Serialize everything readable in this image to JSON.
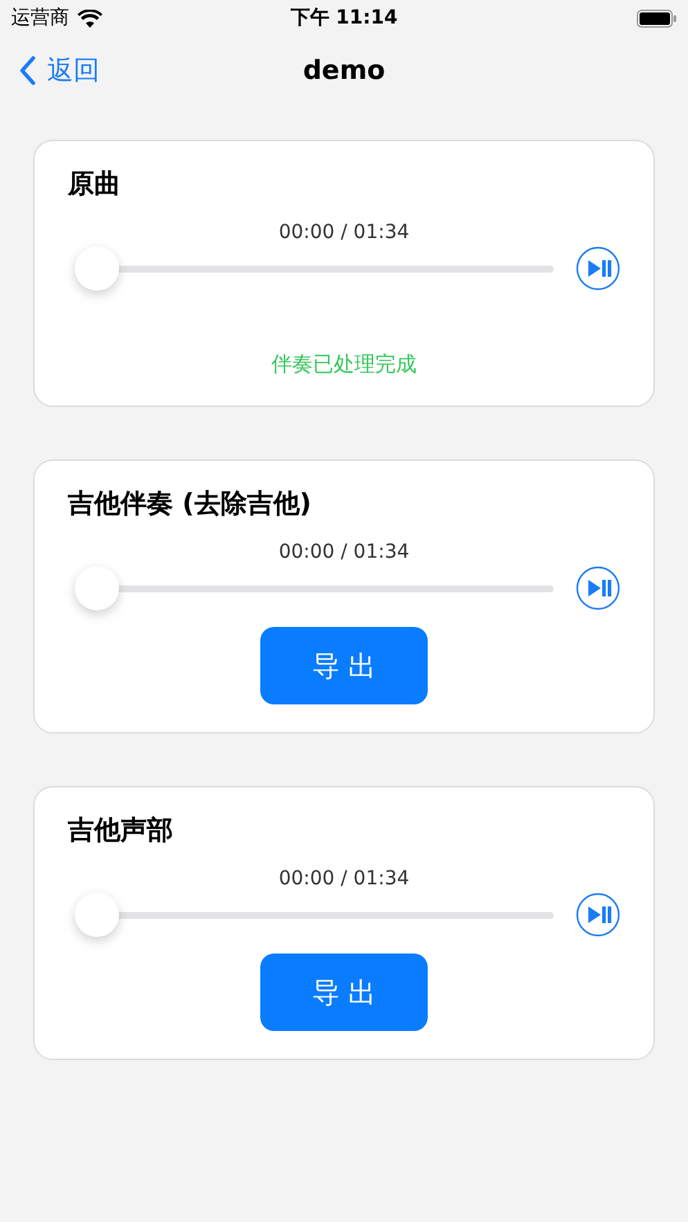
{
  "status_bar": {
    "carrier": "运营商",
    "time": "下午 11:14"
  },
  "nav": {
    "back": "返回",
    "title": "demo"
  },
  "tracks": [
    {
      "title": "原曲",
      "time": "00:00 / 01:34",
      "level": 0,
      "kind": "status",
      "footer": "伴奏已处理完成"
    },
    {
      "title": "吉他伴奏 (去除吉他)",
      "time": "00:00 / 01:34",
      "level": 0,
      "kind": "export",
      "footer": "导 出"
    },
    {
      "title": "吉他声部",
      "time": "00:00 / 01:34",
      "level": 0,
      "kind": "export",
      "footer": "导 出"
    }
  ]
}
